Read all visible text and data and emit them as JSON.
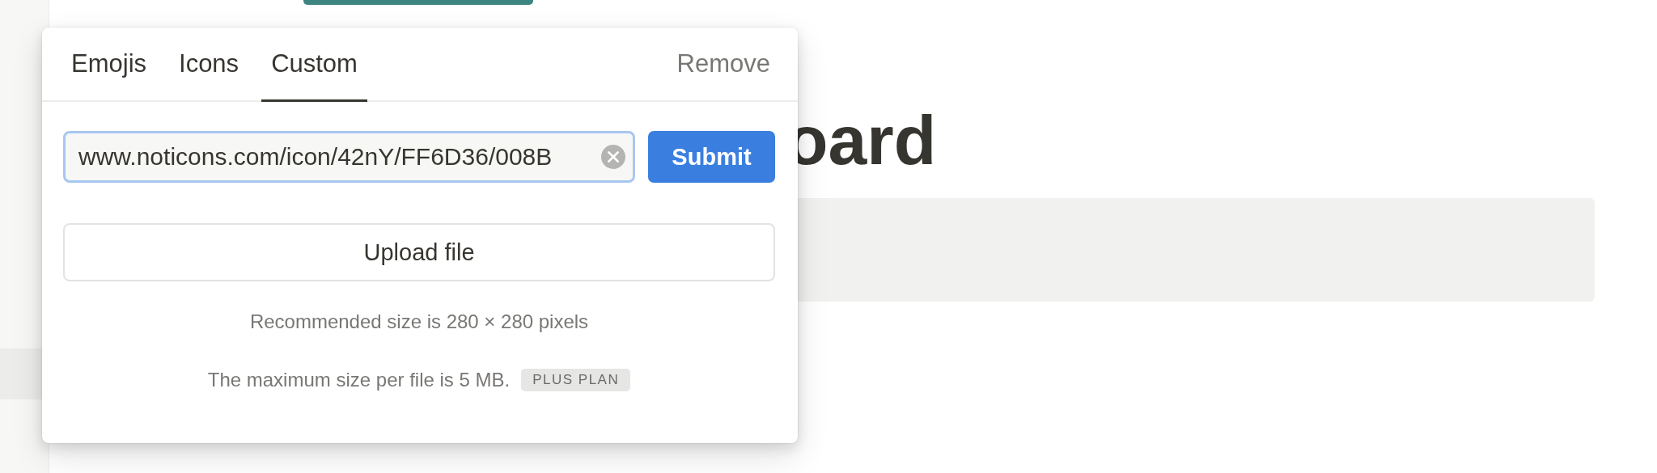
{
  "page": {
    "heading": "oard"
  },
  "popup": {
    "tabs": [
      {
        "label": "Emojis",
        "selected": false
      },
      {
        "label": "Icons",
        "selected": false
      },
      {
        "label": "Custom",
        "selected": true
      }
    ],
    "remove_label": "Remove",
    "url_field": {
      "value": "www.noticons.com/icon/42nY/FF6D36/008B"
    },
    "submit_label": "Submit",
    "upload_label": "Upload file",
    "size_note": "Recommended size is 280 × 280 pixels",
    "limit_note": "The maximum size per file is 5 MB.",
    "plan_badge": "PLUS PLAN"
  }
}
